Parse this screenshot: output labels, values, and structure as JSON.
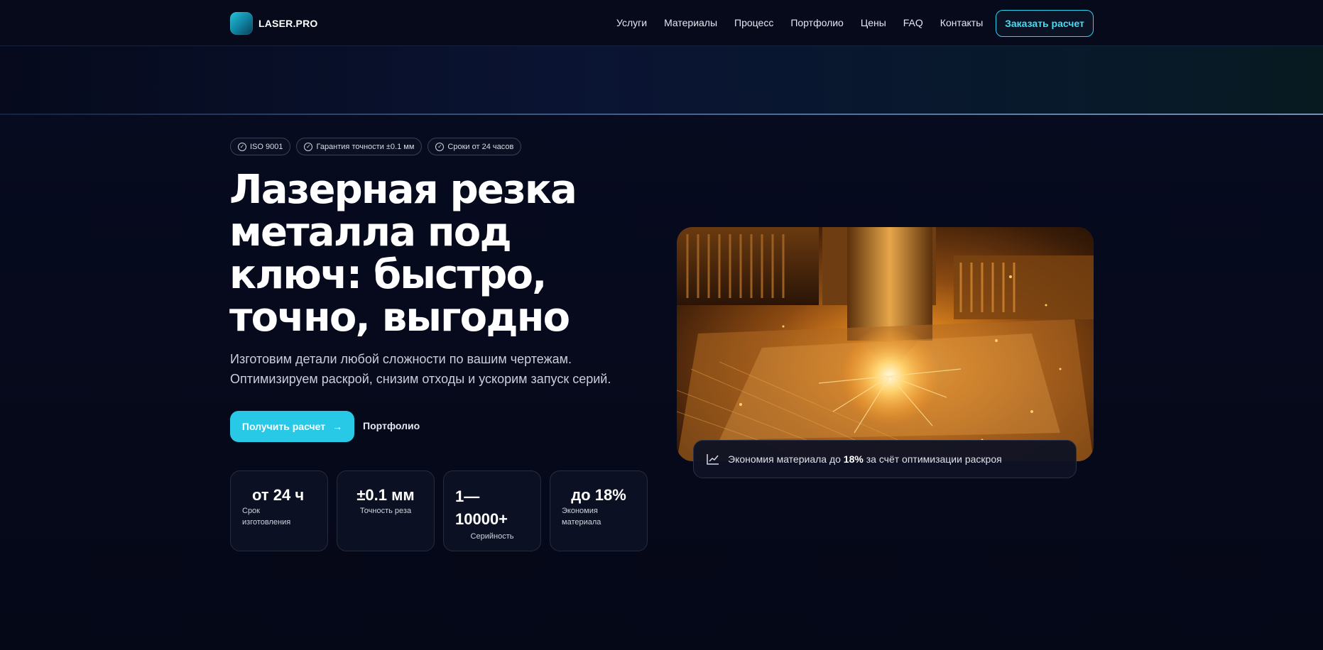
{
  "header": {
    "logo_text": "LASER.PRO",
    "nav": [
      "Услуги",
      "Материалы",
      "Процесс",
      "Портфолио",
      "Цены",
      "FAQ",
      "Контакты"
    ],
    "cta": "Заказать расчет"
  },
  "badges": [
    "ISO 9001",
    "Гарантия точности ±0.1 мм",
    "Сроки от 24 часов"
  ],
  "hero": {
    "title_lines": [
      "Лазерная резка",
      "металла под",
      "ключ: быстро,",
      "точно, выгодно"
    ],
    "subtitle_lines": [
      "Изготовим детали любой сложности по вашим чертежам.",
      "Оптимизируем раскрой, снизим отходы и ускорим запуск серий."
    ],
    "primary_button": "Получить расчет",
    "secondary_link": "Портфолио"
  },
  "stats": [
    {
      "value": "от 24 ч",
      "label": "Срок изготовления"
    },
    {
      "value": "±0.1 мм",
      "label": "Точность реза"
    },
    {
      "value": "1—10000+",
      "label": "Серийность"
    },
    {
      "value": "до 18%",
      "label": "Экономия материала"
    }
  ],
  "savings": {
    "prefix": "Экономия материала до",
    "value": "18%",
    "suffix": "за счёт оптимизации раскроя"
  },
  "colors": {
    "accent": "#27c9e6",
    "background": "#060919"
  }
}
